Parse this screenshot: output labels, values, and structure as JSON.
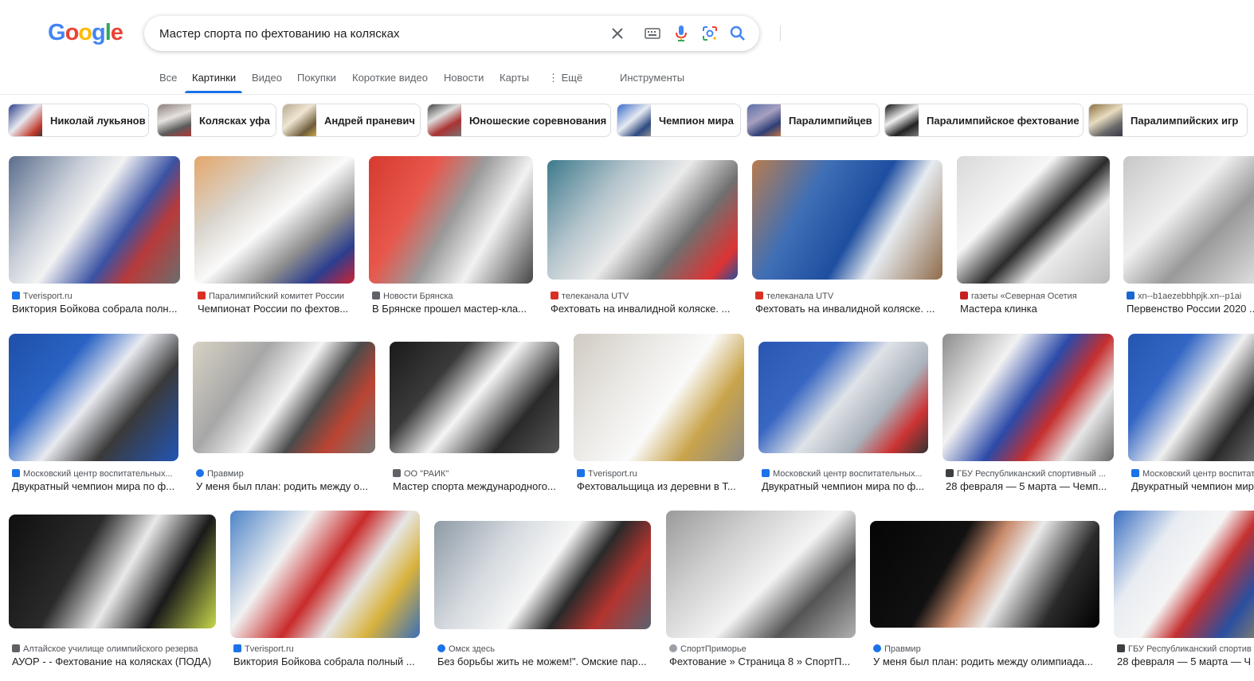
{
  "header": {
    "logo": "Google",
    "search": {
      "value": "Мастер спорта по фехтованию на колясках"
    },
    "icons": {
      "clear": "close-icon",
      "keyboard": "keyboard-icon",
      "voice": "mic-icon",
      "lens": "lens-icon",
      "search": "search-icon"
    }
  },
  "tabs": [
    {
      "label": "Все"
    },
    {
      "label": "Картинки",
      "active": true
    },
    {
      "label": "Видео"
    },
    {
      "label": "Покупки"
    },
    {
      "label": "Короткие видео"
    },
    {
      "label": "Новости"
    },
    {
      "label": "Карты"
    },
    {
      "label": "⋮ Ещё"
    },
    {
      "label": "Инструменты"
    }
  ],
  "chips": [
    {
      "label": "Николай лукьянов"
    },
    {
      "label": "Колясках уфа"
    },
    {
      "label": "Андрей праневич"
    },
    {
      "label": "Юношеские соревнования"
    },
    {
      "label": "Чемпион мира"
    },
    {
      "label": "Паралимпийцев"
    },
    {
      "label": "Паралимпийское фехтование"
    },
    {
      "label": "Паралимпийских игр"
    }
  ],
  "results": [
    {
      "source": "Tverisport.ru",
      "title": "Виктория Бойкова собрала полн...",
      "fav": "#1a73e8"
    },
    {
      "source": "Паралимпийский комитет России",
      "title": "Чемпионат России по фехтов...",
      "fav": "#d93025"
    },
    {
      "source": "Новости Брянска",
      "title": "В Брянске прошел мастер-кла...",
      "fav": "#5f6368"
    },
    {
      "source": "телеканала UTV",
      "title": "Фехтовать на инвалидной коляске. ...",
      "fav": "#d93025"
    },
    {
      "source": "телеканала UTV",
      "title": "Фехтовать на инвалидной коляске. ...",
      "fav": "#d93025"
    },
    {
      "source": "газеты «Северная Осетия",
      "title": "Мастера клинка",
      "fav": "#c5221f"
    },
    {
      "source": "xn--b1aezebbhpjk.xn--p1ai",
      "title": "Первенство России 2020 ...",
      "fav": "#1967d2"
    },
    {
      "source": "Московский центр воспитательных...",
      "title": "Двукратный чемпион мира по ф...",
      "fav": "#1a73e8"
    },
    {
      "source": "Правмир",
      "title": "У меня был план: родить между о...",
      "fav": "#1a73e8"
    },
    {
      "source": "ОО \"РАИК\"",
      "title": "Мастер спорта международного...",
      "fav": "#5f6368"
    },
    {
      "source": "Tverisport.ru",
      "title": "Фехтовальщица из деревни в Т...",
      "fav": "#1a73e8"
    },
    {
      "source": "Московский центр воспитательных...",
      "title": "Двукратный чемпион мира по ф...",
      "fav": "#1a73e8"
    },
    {
      "source": "ГБУ Республиканский спортивный ...",
      "title": "28 февраля — 5 марта — Чемп...",
      "fav": "#3c4043"
    },
    {
      "source": "Московский центр воспитат",
      "title": "Двукратный чемпион мир",
      "fav": "#1a73e8"
    },
    {
      "source": "Алтайское училище олимпийского резерва",
      "title": "АУОР - - Фехтование на колясках (ПОДА)",
      "fav": "#5f6368"
    },
    {
      "source": "Tverisport.ru",
      "title": "Виктория Бойкова собрала полный ...",
      "fav": "#1a73e8"
    },
    {
      "source": "Омск здесь",
      "title": "Без борьбы жить не можем!\". Омские пар...",
      "fav": "#1a73e8"
    },
    {
      "source": "СпортПриморье",
      "title": "Фехтование » Страница 8 » СпортП...",
      "fav": "#9aa0a6"
    },
    {
      "source": "Правмир",
      "title": "У меня был план: родить между олимпиада...",
      "fav": "#1a73e8"
    },
    {
      "source": "ГБУ Республиканский спортив",
      "title": "28 февраля — 5 марта — Ч",
      "fav": "#3c4043"
    }
  ]
}
